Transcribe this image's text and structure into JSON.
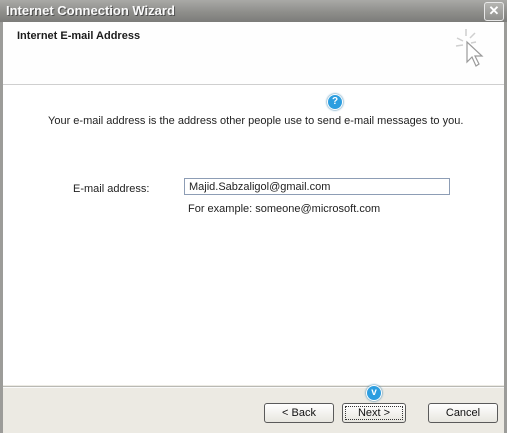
{
  "window": {
    "title": "Internet Connection Wizard",
    "close_label": "✕"
  },
  "header": {
    "title": "Internet E-mail Address"
  },
  "content": {
    "description": "Your e-mail address is the address other people use to send e-mail messages to you.",
    "email_label": "E-mail address:",
    "email_value": "Majid.Sabzaligol@gmail.com",
    "example": "For example: someone@microsoft.com"
  },
  "callouts": {
    "input_badge": "?",
    "next_badge": "v"
  },
  "buttons": {
    "back": "< Back",
    "next": "Next >",
    "cancel": "Cancel"
  },
  "colors": {
    "title_bar": "#8e8e8b",
    "callout": "#2d9ee0"
  },
  "icons": {
    "header_icon": "wizard-cursor-icon"
  }
}
